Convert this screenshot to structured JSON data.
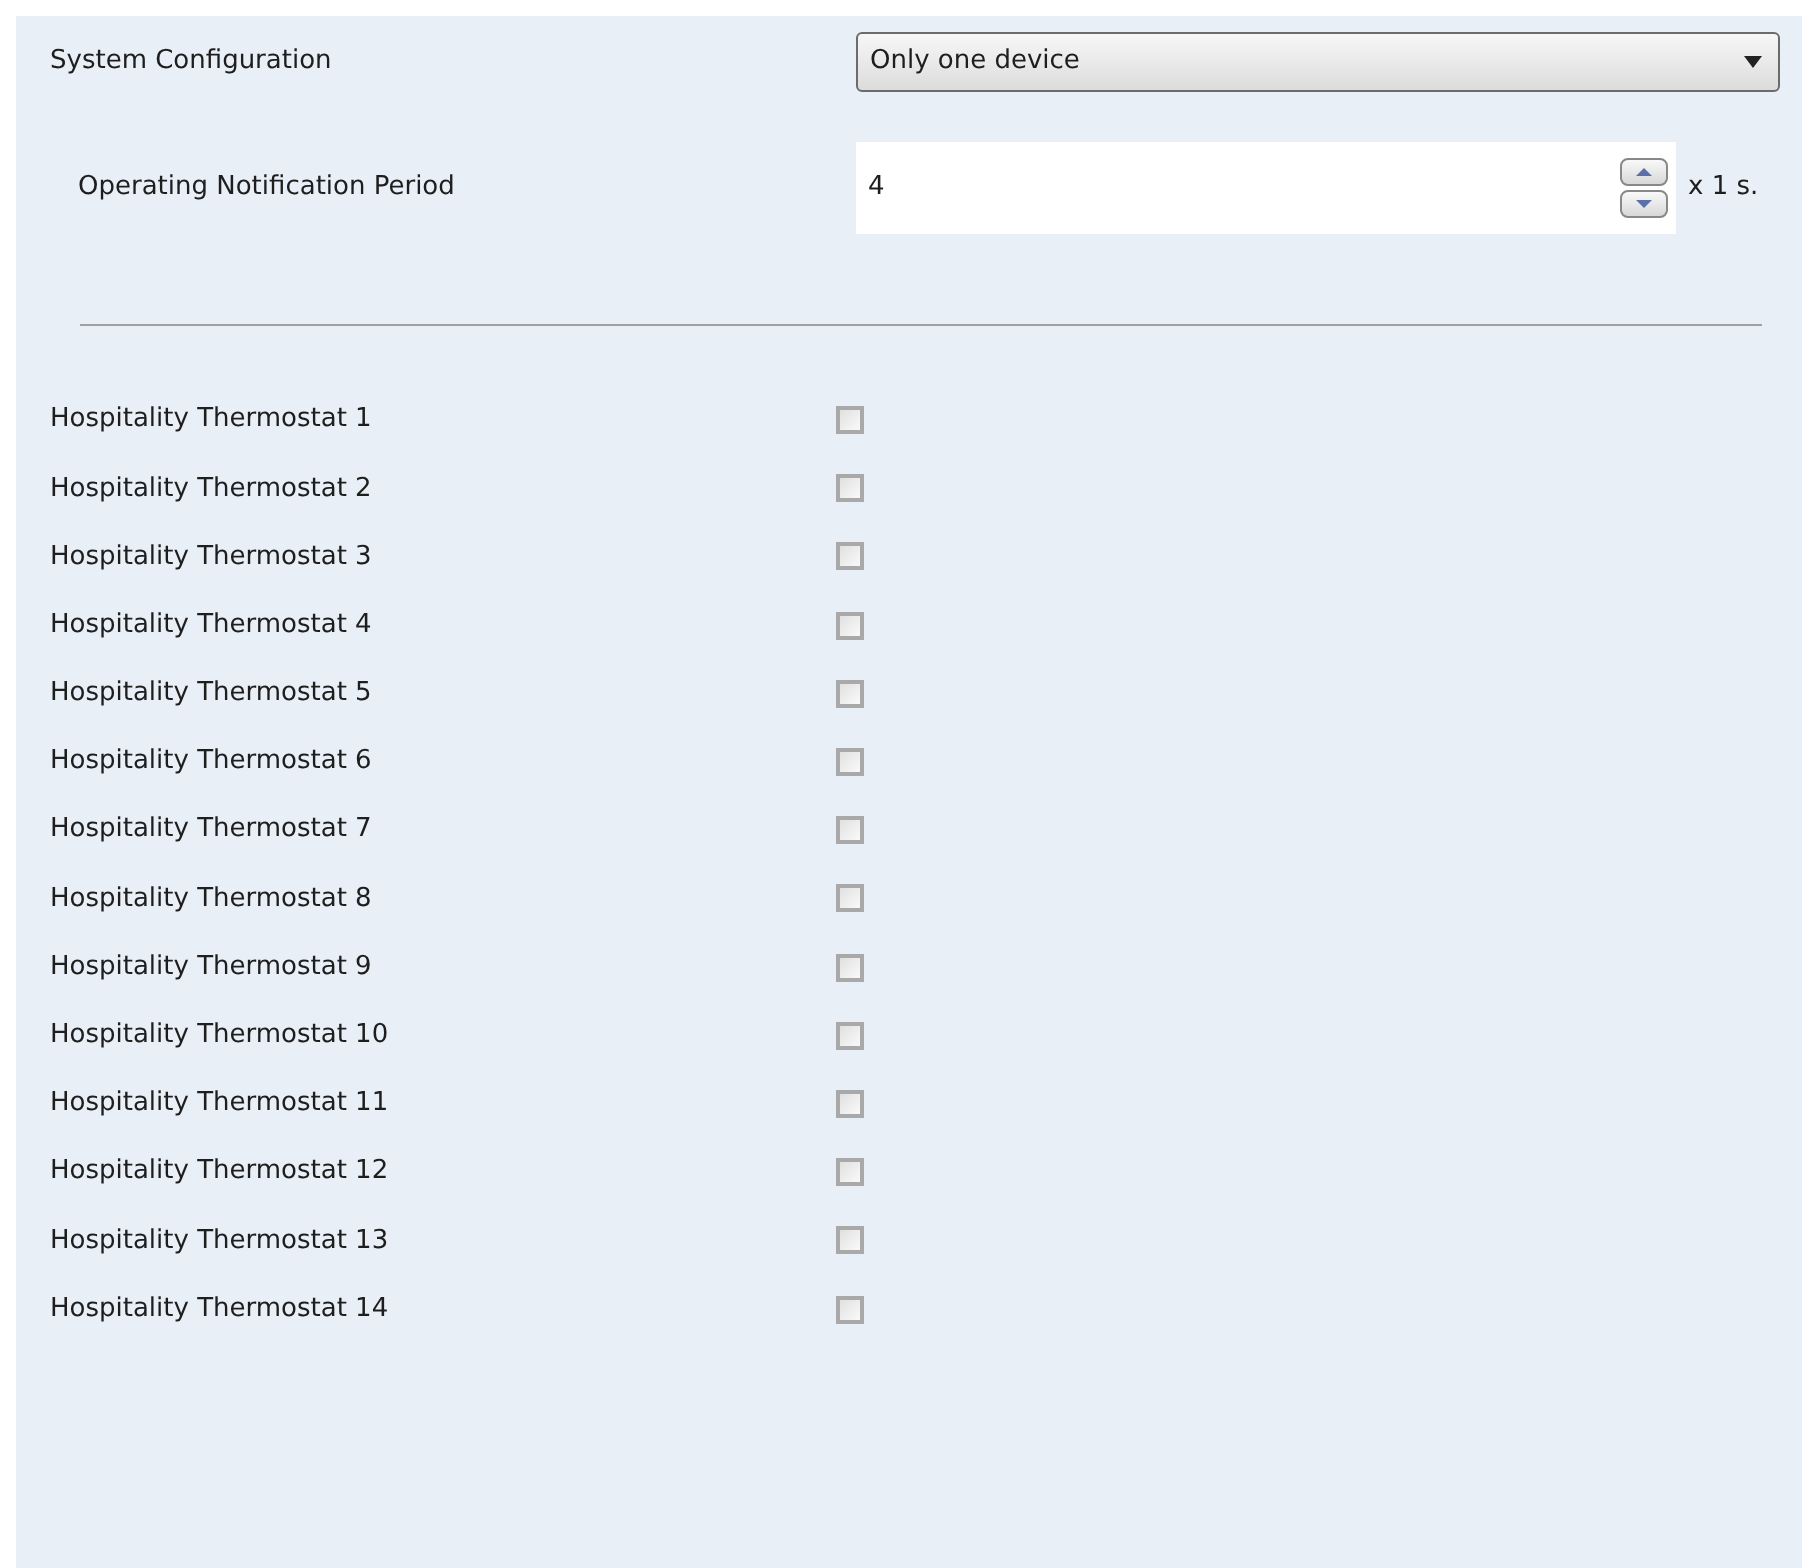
{
  "system_configuration": {
    "label": "System Configuration",
    "value": "Only one device"
  },
  "notification_period": {
    "label": "Operating Notification Period",
    "value": "4",
    "unit": "x 1 s."
  },
  "thermostats": [
    {
      "label": "Hospitality Thermostat 1",
      "checked": false
    },
    {
      "label": "Hospitality Thermostat 2",
      "checked": false
    },
    {
      "label": "Hospitality Thermostat 3",
      "checked": false
    },
    {
      "label": "Hospitality Thermostat 4",
      "checked": false
    },
    {
      "label": "Hospitality Thermostat 5",
      "checked": false
    },
    {
      "label": "Hospitality Thermostat 6",
      "checked": false
    },
    {
      "label": "Hospitality Thermostat 7",
      "checked": false
    },
    {
      "label": "Hospitality Thermostat 8",
      "checked": false
    },
    {
      "label": "Hospitality Thermostat 9",
      "checked": false
    },
    {
      "label": "Hospitality Thermostat 10",
      "checked": false
    },
    {
      "label": "Hospitality Thermostat 11",
      "checked": false
    },
    {
      "label": "Hospitality Thermostat 12",
      "checked": false
    },
    {
      "label": "Hospitality Thermostat 13",
      "checked": false
    },
    {
      "label": "Hospitality Thermostat 14",
      "checked": false
    }
  ]
}
